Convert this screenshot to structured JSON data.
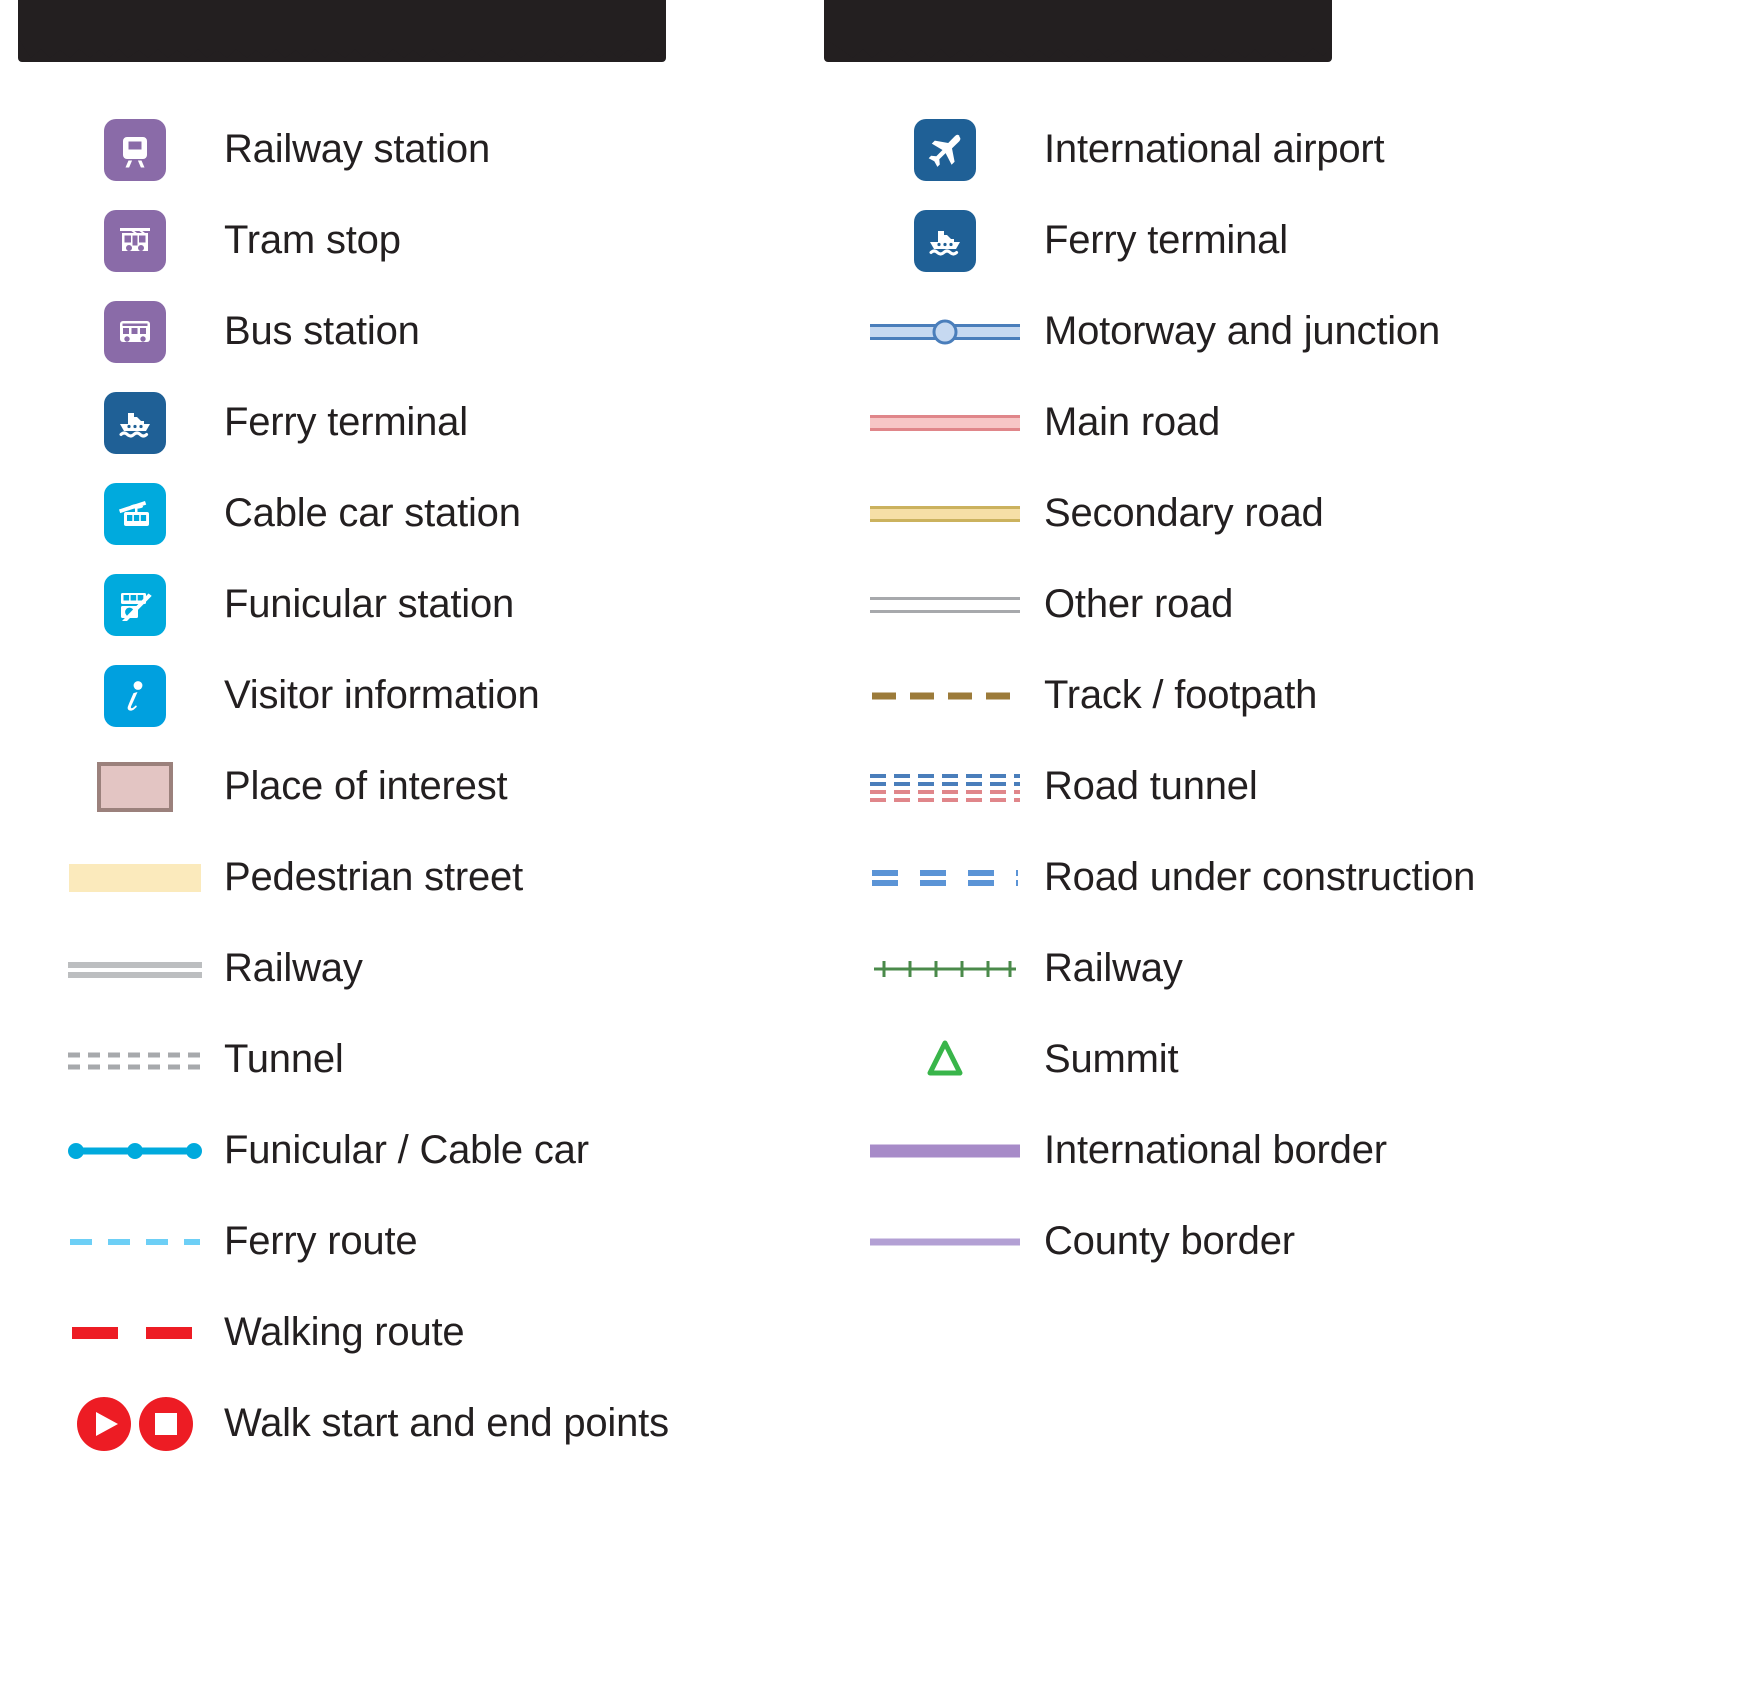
{
  "colors": {
    "heading_bar": "#231f20",
    "purple": "#8a6ba8",
    "dark_blue": "#1f6096",
    "cyan": "#00aadd",
    "poi_fill": "#e3c5c3",
    "poi_border": "#9b817c",
    "pedestrian": "#fbeabc",
    "rail_grey": "#bcbec0",
    "tunnel_grey": "#a7a9ac",
    "ferry_route": "#6dcff6",
    "walking_red": "#ed1c24",
    "motorway_fill": "#c6d9f1",
    "motorway_stroke": "#4a7ebb",
    "main_road_fill": "#f7c6c6",
    "main_road_stroke": "#e0868a",
    "secondary_fill": "#f6dfa6",
    "secondary_stroke": "#cbb25e",
    "other_road_fill": "#ffffff",
    "other_road_stroke": "#a7a9ac",
    "track_brown": "#9c7b3a",
    "rail_green": "#4a8a4a",
    "summit_green": "#39b54a",
    "border_purple": "#a78bc8",
    "county_purple": "#b3a0d4",
    "white": "#ffffff"
  },
  "left_column": {
    "heading": "",
    "items": [
      {
        "symbol": "railway-station-icon",
        "label": "Railway station"
      },
      {
        "symbol": "tram-stop-icon",
        "label": "Tram stop"
      },
      {
        "symbol": "bus-station-icon",
        "label": "Bus station"
      },
      {
        "symbol": "ferry-terminal-icon",
        "label": "Ferry terminal"
      },
      {
        "symbol": "cable-car-icon",
        "label": "Cable car station"
      },
      {
        "symbol": "funicular-icon",
        "label": "Funicular station"
      },
      {
        "symbol": "visitor-information-icon",
        "label": "Visitor information"
      },
      {
        "symbol": "place-of-interest-swatch",
        "label": "Place of interest"
      },
      {
        "symbol": "pedestrian-street-swatch",
        "label": "Pedestrian street"
      },
      {
        "symbol": "railway-line",
        "label": "Railway"
      },
      {
        "symbol": "tunnel-line",
        "label": "Tunnel"
      },
      {
        "symbol": "funicular-cable-line",
        "label": "Funicular / Cable car"
      },
      {
        "symbol": "ferry-route-line",
        "label": "Ferry route"
      },
      {
        "symbol": "walking-route-line",
        "label": "Walking route"
      },
      {
        "symbol": "walk-start-end-markers",
        "label": "Walk start and end points"
      }
    ]
  },
  "right_column": {
    "heading": "",
    "items": [
      {
        "symbol": "international-airport-icon",
        "label": "International airport"
      },
      {
        "symbol": "ferry-terminal-icon",
        "label": "Ferry terminal"
      },
      {
        "symbol": "motorway-junction-line",
        "label": "Motorway and junction"
      },
      {
        "symbol": "main-road-line",
        "label": "Main road"
      },
      {
        "symbol": "secondary-road-line",
        "label": "Secondary road"
      },
      {
        "symbol": "other-road-line",
        "label": "Other road"
      },
      {
        "symbol": "track-footpath-line",
        "label": "Track / footpath"
      },
      {
        "symbol": "road-tunnel-line",
        "label": "Road tunnel"
      },
      {
        "symbol": "road-construction-line",
        "label": "Road under construction"
      },
      {
        "symbol": "railway-green-line",
        "label": "Railway"
      },
      {
        "symbol": "summit-icon",
        "label": "Summit"
      },
      {
        "symbol": "international-border-line",
        "label": "International border"
      },
      {
        "symbol": "county-border-line",
        "label": "County border"
      }
    ]
  }
}
